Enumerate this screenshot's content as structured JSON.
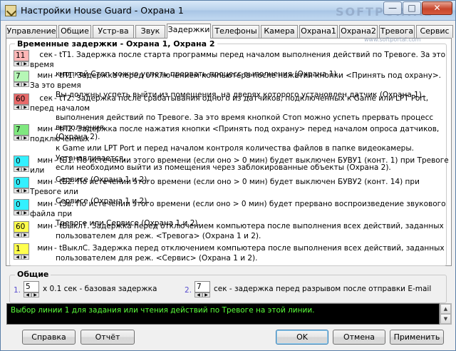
{
  "window": {
    "title": "Настройки House Guard - Охрана 1",
    "watermark": "SOFTPORTAL",
    "watermark_url": "www.softportal.com"
  },
  "tabs": [
    {
      "label": "Управление",
      "active": false
    },
    {
      "label": "Общие",
      "active": false
    },
    {
      "label": "Устр-ва",
      "active": false
    },
    {
      "label": "Звук",
      "active": false
    },
    {
      "label": "Задержки",
      "active": true
    },
    {
      "label": "Телефоны",
      "active": false
    },
    {
      "label": "Камера",
      "active": false
    },
    {
      "label": "Охрана1",
      "active": false
    },
    {
      "label": "Охрана2",
      "active": false
    },
    {
      "label": "Тревога",
      "active": false
    },
    {
      "label": "Сервис",
      "active": false
    }
  ],
  "delays": {
    "group_title": "Временные задержки - Охрана 1, Охрана 2",
    "rows": [
      {
        "value": "11",
        "color": "#ffb6b6",
        "unit": "сек",
        "line1": "- tT1. Задержка после старта программы перед началом выполнения действий по Тревоге. За это время",
        "line2": "кнопкой Стоп можно успеть прервать процесс выполнения (Охрана 1).",
        "line3": ""
      },
      {
        "value": "7",
        "color": "#b6f7b6",
        "unit": "мин",
        "line1": "- tП1. Задержка перед отключением компьютера после нажатия кнопки <Принять под охрану>. За это время",
        "line2": "Вы должны успеть выйти из помещения, на дверях которого установлен датчик (Охрана 1).",
        "line3": ""
      },
      {
        "value": "60",
        "color": "#e96a6a",
        "unit": "сек",
        "line1": "- tT2. Задержка после срабатывания одного из датчиков, подключенных к Game или LPT Port, перед началом",
        "line2": "выполнения действий по Тревоге. За это время кнопкой Стоп можно успеть прервать процесс выполнения",
        "line3": "(Охрана 2)."
      },
      {
        "value": "7",
        "color": "#7fe87f",
        "unit": "мин",
        "line1": "- tП2. Задержка после нажатия кнопки <Принять под охрану> перед началом опроса датчиков, подключенных",
        "line2": "к Game или LPT Port и перед началом контроля количества файлов в папке видеокамеры. Устанавливается,",
        "line3": "если необходимо выйти из помещения через заблокированные объекты (Охрана 2)."
      },
      {
        "value": "0",
        "color": "#33f0ff",
        "unit": "мин",
        "line1": "- tБ1. По истечении этого времени (если оно > 0 мин) будет выключен БУВУ1 (конт. 1) при Тревоге или",
        "line2": "Сервисе (Охрана 1 и 2).",
        "line3": ""
      },
      {
        "value": "0",
        "color": "#33f0ff",
        "unit": "мин",
        "line1": "- tБ2. По истечении этого времени (если оно > 0 мин) будет выключен БУВУ2 (конт. 14) при Тревоге или",
        "line2": "Сервисе (Охрана 1 и 2).",
        "line3": ""
      },
      {
        "value": "0",
        "color": "#33f0ff",
        "unit": "мин",
        "line1": "- t3в. По истечении этого времени (если оно > 0 мин) будет прервано воспроизведение звукового файла при",
        "line2": "Тревоге или Сервисе (Охрана 1 и 2).",
        "line3": ""
      },
      {
        "value": "60",
        "color": "#ffff4d",
        "unit": "мин",
        "line1": "- tВыклТ. Задержка перед отключением компьютера после выполнения всех действий, заданных",
        "line2": "пользователем для реж. <Тревога> (Охрана 1 и 2).",
        "line3": ""
      },
      {
        "value": "1",
        "color": "#ffff4d",
        "unit": "мин",
        "line1": "- tВыклС. Задержка перед отключением компьютера после выполнения всех действий, заданных",
        "line2": "пользователем для реж. <Сервис> (Охрана 1 и 2).",
        "line3": ""
      }
    ]
  },
  "general": {
    "title": "Общие",
    "item1": {
      "num": "1.",
      "value": "5",
      "text": "x 0.1 сек - базовая задержка"
    },
    "item2": {
      "num": "2.",
      "value": "7",
      "text": "сек - задержка перед разрывом после отправки E-mail"
    }
  },
  "console": {
    "text": "Выбор линии 1 для задания или чтения действий по Тревоге на этой линии."
  },
  "buttons": {
    "help": "Справка",
    "report": "Отчёт",
    "ok": "OK",
    "cancel": "Отмена",
    "apply": "Применить"
  }
}
